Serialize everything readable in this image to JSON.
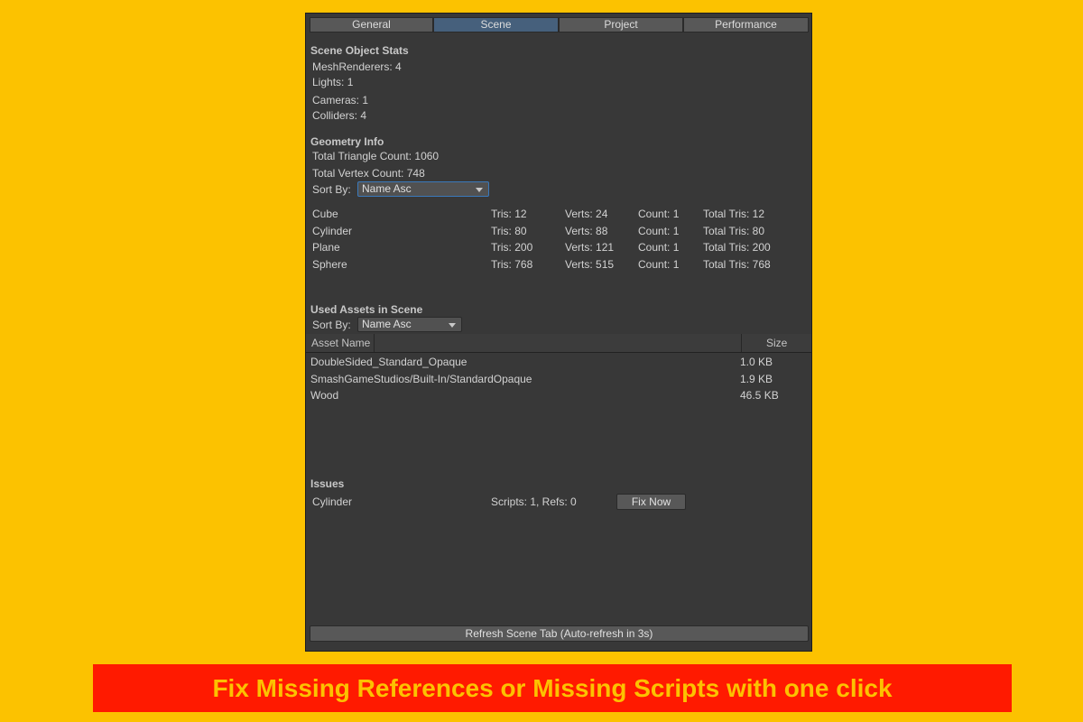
{
  "tabs": [
    "General",
    "Scene",
    "Project",
    "Performance"
  ],
  "scene_stats": {
    "title": "Scene Object Stats",
    "items": [
      "MeshRenderers: 4",
      "Lights: 1",
      "Cameras: 1",
      "Colliders: 4"
    ]
  },
  "geometry": {
    "title": "Geometry Info",
    "total_tris": "Total Triangle Count: 1060",
    "total_verts": "Total Vertex Count: 748",
    "sort_label": "Sort By:",
    "sort_value": "Name Asc",
    "rows": [
      {
        "name": "Cube",
        "tris": "Tris: 12",
        "verts": "Verts: 24",
        "count": "Count: 1",
        "total": "Total Tris: 12"
      },
      {
        "name": "Cylinder",
        "tris": "Tris: 80",
        "verts": "Verts: 88",
        "count": "Count: 1",
        "total": "Total Tris: 80"
      },
      {
        "name": "Plane",
        "tris": "Tris: 200",
        "verts": "Verts: 121",
        "count": "Count: 1",
        "total": "Total Tris: 200"
      },
      {
        "name": "Sphere",
        "tris": "Tris: 768",
        "verts": "Verts: 515",
        "count": "Count: 1",
        "total": "Total Tris: 768"
      }
    ]
  },
  "assets": {
    "title": "Used Assets in Scene",
    "sort_label": "Sort By:",
    "sort_value": "Name Asc",
    "col_name": "Asset Name",
    "col_size": "Size",
    "rows": [
      {
        "name": "DoubleSided_Standard_Opaque",
        "size": "1.0 KB"
      },
      {
        "name": "SmashGameStudios/Built-In/StandardOpaque",
        "size": "1.9 KB"
      },
      {
        "name": "Wood",
        "size": "46.5 KB"
      }
    ]
  },
  "issues": {
    "title": "Issues",
    "rows": [
      {
        "name": "Cylinder",
        "detail": "Scripts: 1, Refs: 0",
        "button": "Fix Now"
      }
    ]
  },
  "refresh_button": "Refresh Scene Tab (Auto-refresh in 3s)",
  "banner": "Fix Missing References or Missing Scripts with one click"
}
